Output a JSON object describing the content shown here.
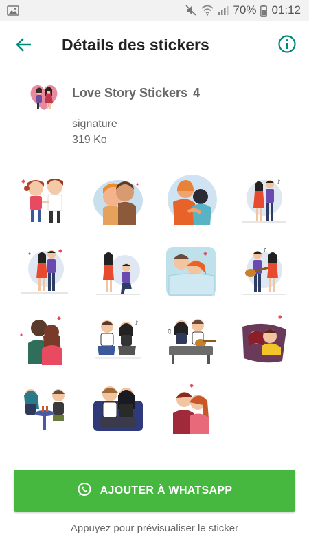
{
  "status_bar": {
    "battery": "70%",
    "time": "01:12",
    "icons": [
      "gallery-icon",
      "mute-icon",
      "wifi-icon",
      "signal-icon",
      "battery-icon"
    ]
  },
  "app_bar": {
    "title": "Détails des stickers",
    "back_icon": "arrow-left-icon",
    "info_icon": "info-icon",
    "accent_color": "#00897b"
  },
  "pack": {
    "name": "Love Story Stickers",
    "count": "4",
    "author": "signature",
    "size": "319 Ko"
  },
  "stickers": [
    {
      "name": "couple-holding-hands"
    },
    {
      "name": "couple-cheek-to-cheek"
    },
    {
      "name": "couple-hug-back"
    },
    {
      "name": "couple-singing"
    },
    {
      "name": "couple-heart-pose"
    },
    {
      "name": "proposal-kneeling"
    },
    {
      "name": "couple-in-bed"
    },
    {
      "name": "guitar-serenade"
    },
    {
      "name": "couple-hug-hearts"
    },
    {
      "name": "couple-sitting-music"
    },
    {
      "name": "couple-guitar-bench"
    },
    {
      "name": "couple-kiss-pillow"
    },
    {
      "name": "couple-cafe-table"
    },
    {
      "name": "couple-sofa"
    },
    {
      "name": "couple-kiss-cheek"
    }
  ],
  "actions": {
    "add_label": "AJOUTER À WHATSAPP",
    "add_icon": "whatsapp-icon",
    "button_color": "#47b83f",
    "hint": "Appuyez pour prévisualiser le sticker"
  }
}
